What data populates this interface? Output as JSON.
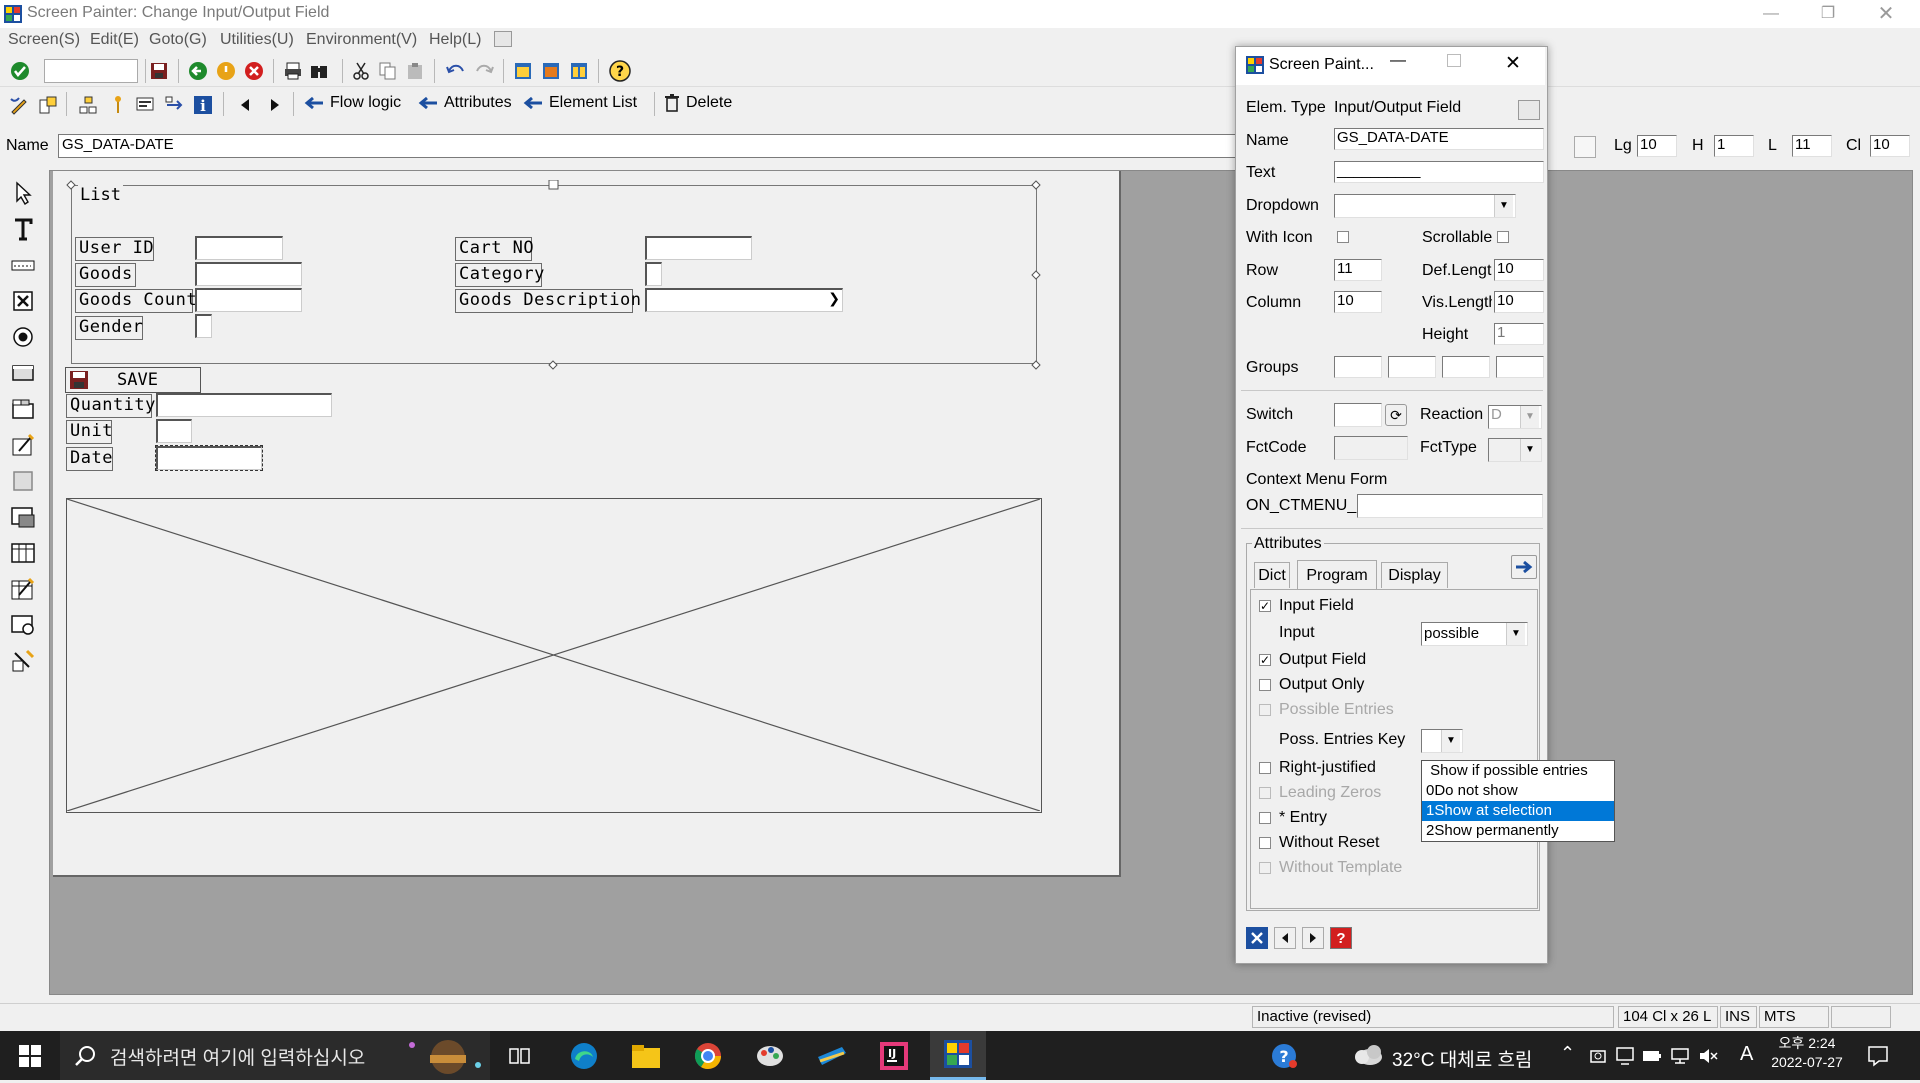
{
  "window": {
    "title": "Screen Painter:  Change Input/Output Field"
  },
  "menu": [
    "Screen(S)",
    "Edit(E)",
    "Goto(G)",
    "Utilities(U)",
    "Environment(V)",
    "Help(L)"
  ],
  "toolbar2": {
    "flow_logic": "Flow logic",
    "attributes": "Attributes",
    "element_list": "Element List",
    "delete": "Delete"
  },
  "namebar": {
    "label": "Name",
    "value": "GS_DATA-DATE",
    "lg_label": "Lg",
    "lg": "10",
    "h_label": "H",
    "h": "1",
    "l_label": "L",
    "l": "11",
    "cl_label": "Cl",
    "cl": "10"
  },
  "canvas": {
    "frame_title": "List",
    "labels": {
      "user_id": "User ID",
      "goods": "Goods",
      "goods_count": "Goods Count",
      "gender": "Gender",
      "cart_no": "Cart NO",
      "category": "Category",
      "goods_desc": "Goods Description",
      "quantity": "Quantity",
      "unit": "Unit",
      "date": "Date"
    },
    "save_button": "SAVE"
  },
  "dialog": {
    "title": "Screen Paint...",
    "elem_type_label": "Elem. Type",
    "elem_type": "Input/Output Field",
    "name_label": "Name",
    "name": "GS_DATA-DATE",
    "text_label": "Text",
    "text": "__________",
    "dropdown_label": "Dropdown",
    "with_icon_label": "With Icon",
    "scrollable_label": "Scrollable",
    "row_label": "Row",
    "row": "11",
    "column_label": "Column",
    "column": "10",
    "def_length_label": "Def.Length",
    "def_length": "10",
    "vis_length_label": "Vis.Length",
    "vis_length": "10",
    "height_label": "Height",
    "height": "1",
    "groups_label": "Groups",
    "switch_label": "Switch",
    "reaction_label": "Reaction",
    "reaction": "D",
    "fctcode_label": "FctCode",
    "fcttype_label": "FctType",
    "context_menu_label": "Context Menu Form",
    "ctmenu_prefix": "ON_CTMENU_",
    "attributes_title": "Attributes",
    "tabs": [
      "Dict",
      "Program",
      "Display"
    ],
    "input_field_label": "Input Field",
    "input_label": "Input",
    "input_value": "possible",
    "output_field_label": "Output Field",
    "output_only_label": "Output Only",
    "possible_entries_label": "Possible Entries",
    "poss_entries_key_label": "Poss. Entries Key",
    "right_justified_label": "Right-justified",
    "leading_zeros_label": "Leading Zeros",
    "entry_label": "* Entry",
    "without_reset_label": "Without Reset",
    "without_template_label": "Without Template",
    "poss_dropdown_options": [
      " Show if possible entries",
      "0Do not show",
      "1Show at selection",
      "2Show permanently"
    ],
    "poss_dropdown_selected": "1Show at selection"
  },
  "status": {
    "state": "Inactive (revised)",
    "size": "104 Cl x 26 L",
    "mode": "INS",
    "system": "MTS"
  },
  "taskbar": {
    "search_placeholder": "검색하려면 여기에 입력하십시오",
    "weather": "32°C  대체로 흐림",
    "ime": "A",
    "time": "오후 2:24",
    "date": "2022-07-27"
  },
  "colors": {
    "selection": "#0078d7",
    "taskbar": "#1f1f1f",
    "canvas_bg": "#a0a0a0"
  }
}
